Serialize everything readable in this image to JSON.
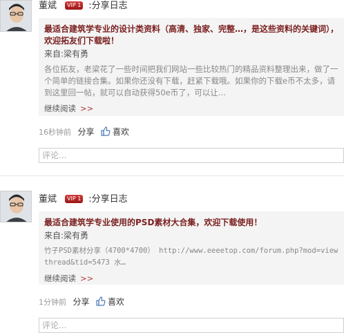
{
  "posts": [
    {
      "user_name": "董斌",
      "badge": "VIP 1",
      "action": ":分享日志",
      "title": "最适合建筑学专业的设计类资料（高清、独家、完整…，是这些资料的关键词），欢迎拓友们下载啦！",
      "from_label": "来自:",
      "from_name": "梁有勇",
      "excerpt": "各位拓友，老梁花了一些时间把我们网站一些比较热门的精品资料整理出来，做了一个简单的链接合集。如果你还没有下载，赶紧下载哦。如果你的下载e币不太多，请到这里回一帖，就可以自动获得50e币了，可以让…",
      "more_label": "继续阅读",
      "more_arrows": ">>",
      "time": "16秒钟前",
      "share_label": "分享",
      "like_label": "喜欢",
      "comment_placeholder": "评论..."
    },
    {
      "user_name": "董斌",
      "badge": "VIP 1",
      "action": ":分享日志",
      "title": "最适合建筑学专业使用的PSD素材大合集，欢迎下载使用！",
      "from_label": "来自:",
      "from_name": "梁有勇",
      "excerpt": "竹子PSD素材分享（4700*4700） http://www.eeeetop.com/forum.php?mod=viewthread&tid=5473 水…",
      "more_label": "继续阅读",
      "more_arrows": ">>",
      "time": "1分钟前",
      "share_label": "分享",
      "like_label": "喜欢",
      "comment_placeholder": "评论..."
    }
  ]
}
